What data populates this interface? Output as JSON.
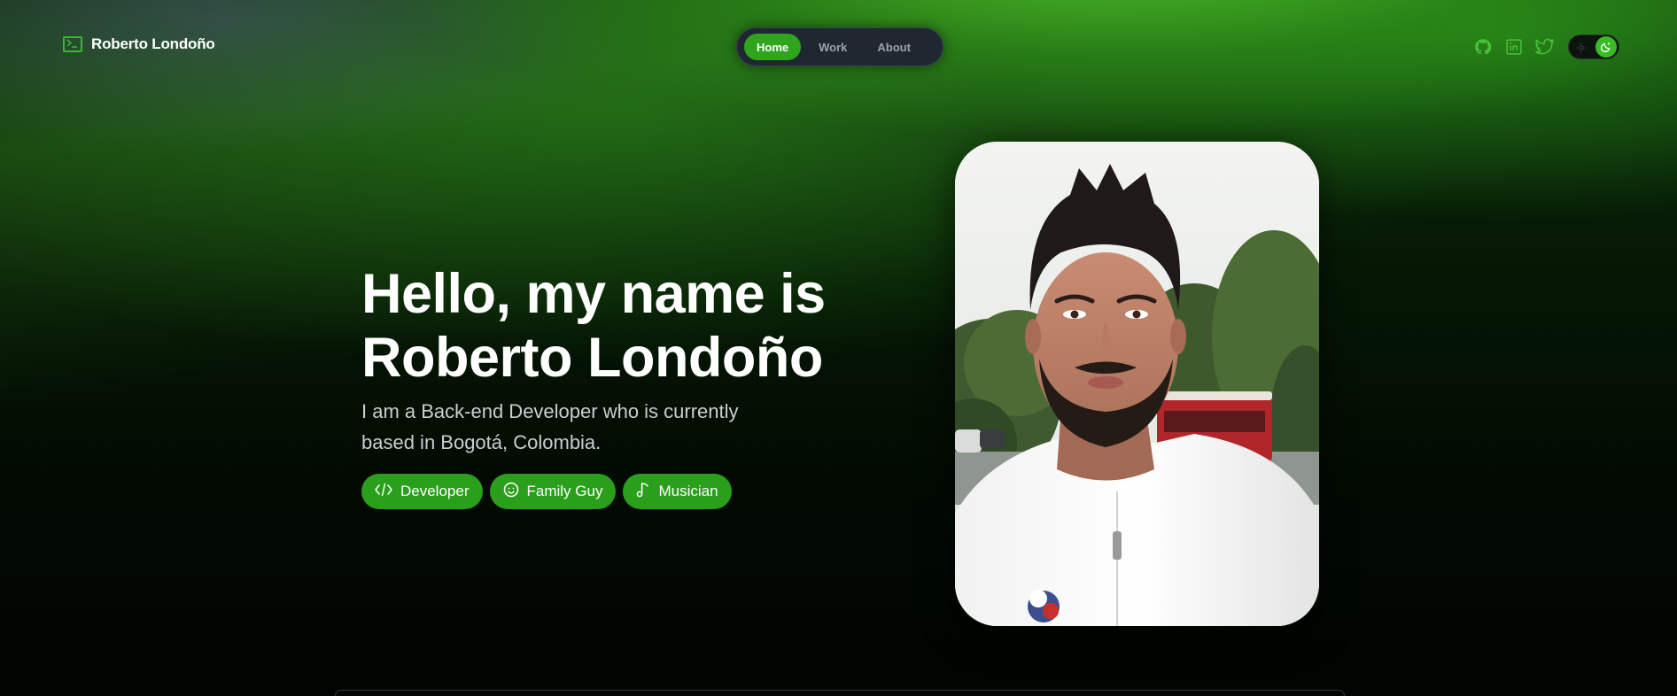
{
  "header": {
    "brand_name": "Roberto Londoño",
    "brand_icon": "terminal-icon",
    "nav": [
      {
        "label": "Home",
        "active": true
      },
      {
        "label": "Work",
        "active": false
      },
      {
        "label": "About",
        "active": false
      }
    ],
    "social_icons": [
      "github-icon",
      "linkedin-icon",
      "twitter-icon"
    ],
    "theme_toggle": {
      "mode": "dark"
    }
  },
  "hero": {
    "title_line1": "Hello, my name is",
    "title_line2": "Roberto Londoño",
    "subtitle_line1": "I am a Back-end Developer who is currently",
    "subtitle_line2": "based in Bogotá, Colombia.",
    "chips": [
      {
        "label": "Developer",
        "icon": "code-icon"
      },
      {
        "label": "Family Guy",
        "icon": "smiley-icon"
      },
      {
        "label": "Musician",
        "icon": "music-note-icon"
      }
    ]
  },
  "colors": {
    "accent": "#2fa51e",
    "nav_bg": "#1f2730",
    "text_muted": "#c8ced2"
  }
}
